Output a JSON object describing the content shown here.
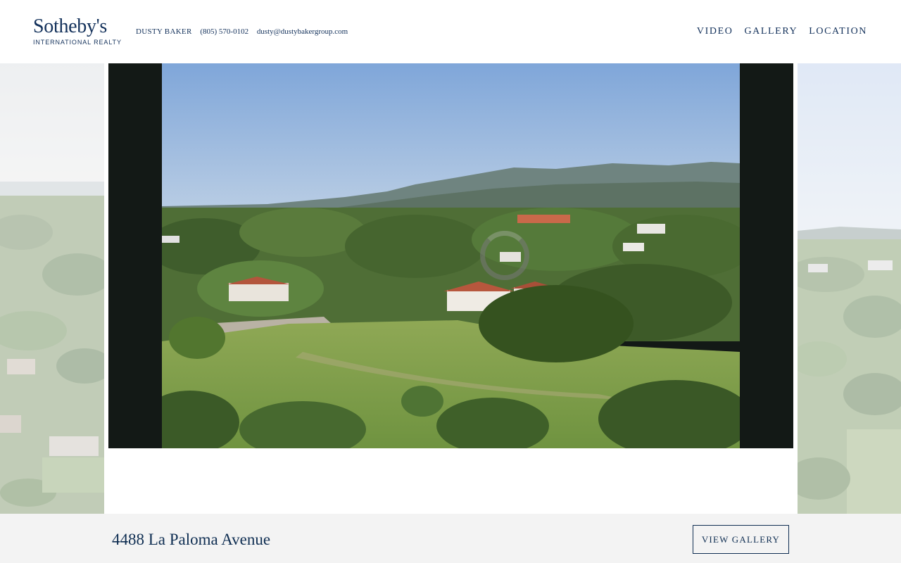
{
  "brand": {
    "name": "Sotheby's",
    "subtitle": "INTERNATIONAL REALTY"
  },
  "agent": {
    "name": "DUSTY BAKER",
    "phone": "(805) 570-0102",
    "email": "dusty@dustybakergroup.com"
  },
  "nav": {
    "items": [
      {
        "label": "VIDEO"
      },
      {
        "label": "GALLERY"
      },
      {
        "label": "LOCATION"
      }
    ]
  },
  "gallery": {
    "state": "loading",
    "current_image": "aerial-view-of-property"
  },
  "listing": {
    "address": "4488 La Paloma Avenue",
    "cta_label": "VIEW GALLERY"
  },
  "colors": {
    "brand_navy": "#12305a",
    "frame_dark": "#131916",
    "bar_background": "#f3f3f3"
  }
}
